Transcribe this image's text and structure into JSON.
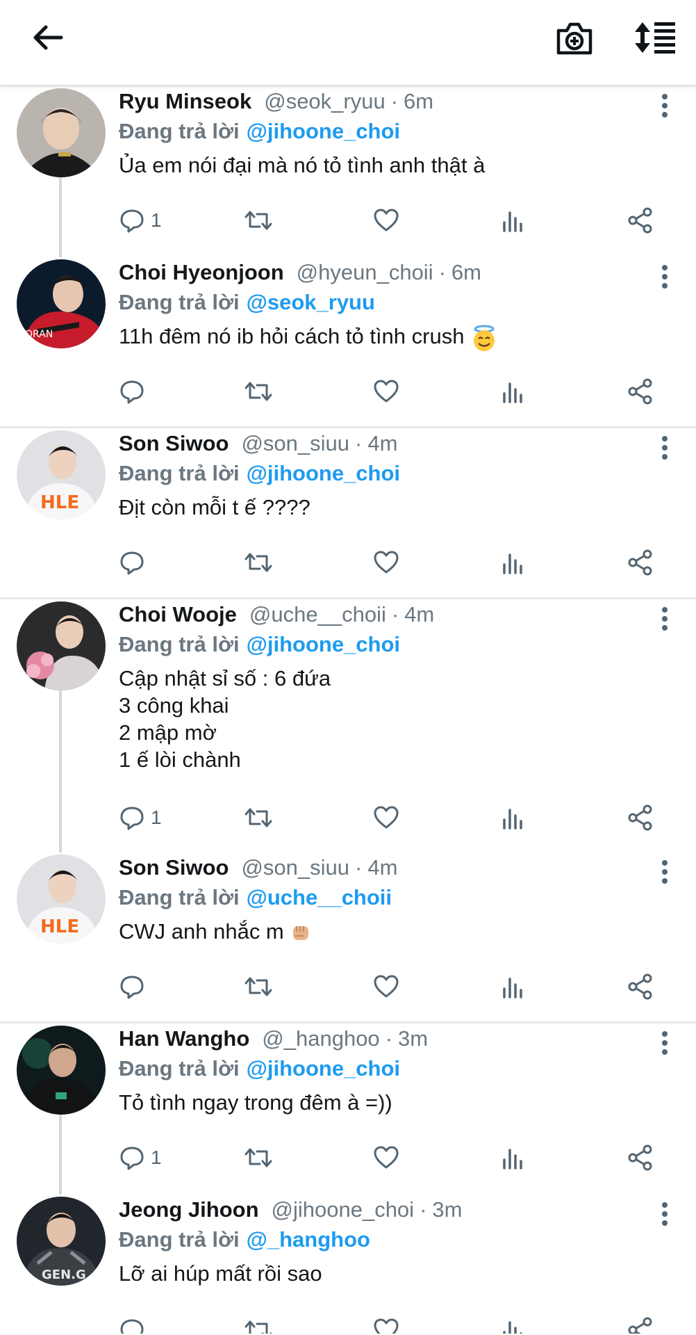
{
  "colors": {
    "link": "#1d9bf0",
    "muted": "#6b7780",
    "text": "#14171a",
    "separator": "#e6e9eb"
  },
  "header": {
    "back_icon": "arrow-left-icon",
    "camera_icon": "camera-plus-icon",
    "sort_icon": "sort-icon"
  },
  "labels": {
    "replying_to": "Đang trả lời"
  },
  "tweets": [
    {
      "name": "Ryu Minseok",
      "handle": "@seok_ryuu",
      "time": "6m",
      "reply_to": "@jihoone_choi",
      "lines": [
        "Ủa em nói đại mà nó tỏ tình anh thật à"
      ],
      "reply_count": "1"
    },
    {
      "name": "Choi Hyeonjoon",
      "handle": "@hyeun_choii",
      "time": "6m",
      "reply_to": "@seok_ryuu",
      "lines": [
        "11h đêm nó ib hỏi cách tỏ tình crush"
      ],
      "emoji": "smiling-face-with-halo",
      "reply_count": ""
    },
    {
      "name": "Son Siwoo",
      "handle": "@son_siuu",
      "time": "4m",
      "reply_to": "@jihoone_choi",
      "lines": [
        "Địt còn mỗi t ế ????"
      ],
      "reply_count": ""
    },
    {
      "name": "Choi Wooje",
      "handle": "@uche__choii",
      "time": "4m",
      "reply_to": "@jihoone_choi",
      "lines": [
        "Cập nhật sỉ số : 6 đứa",
        "3 công khai",
        "2 mập mờ",
        "1 ế lòi chành"
      ],
      "reply_count": "1"
    },
    {
      "name": "Son Siwoo",
      "handle": "@son_siuu",
      "time": "4m",
      "reply_to": "@uche__choii",
      "lines": [
        "CWJ anh nhắc m"
      ],
      "emoji": "oncoming-fist",
      "reply_count": ""
    },
    {
      "name": "Han Wangho",
      "handle": "@_hanghoo",
      "time": "3m",
      "reply_to": "@jihoone_choi",
      "lines": [
        "Tỏ tình ngay trong đêm à =))"
      ],
      "reply_count": "1"
    },
    {
      "name": "Jeong Jihoon",
      "handle": "@jihoone_choi",
      "time": "3m",
      "reply_to": "@_hanghoo",
      "lines": [
        "Lỡ ai húp mất rồi sao"
      ],
      "reply_count": ""
    }
  ]
}
